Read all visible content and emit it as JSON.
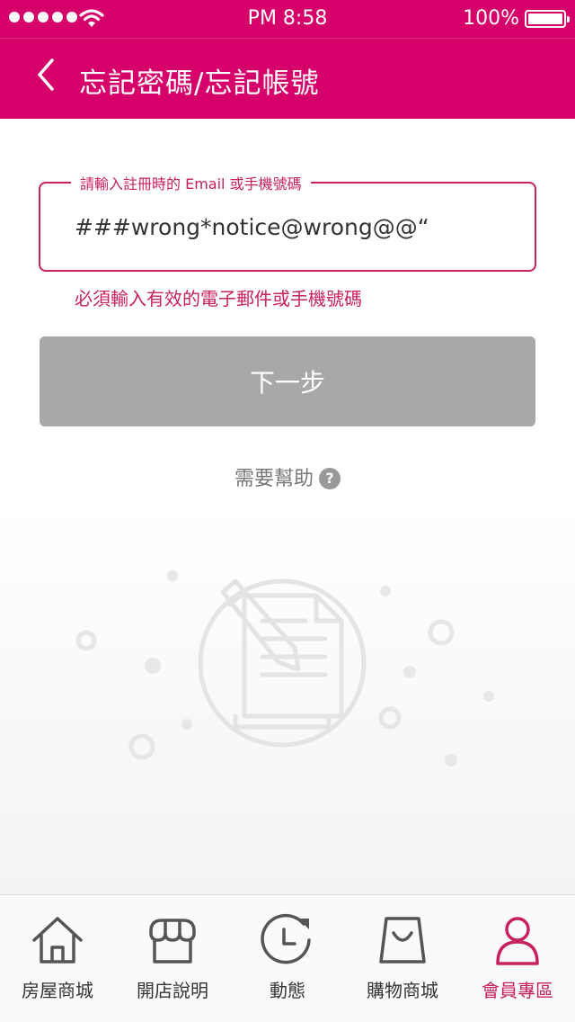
{
  "status_bar": {
    "time": "PM 8:58",
    "battery": "100%"
  },
  "header": {
    "title": "忘記密碼/忘記帳號",
    "back_icon": "chevron-left-icon"
  },
  "form": {
    "field_label": "請輸入註冊時的 Email 或手機號碼",
    "field_value": "###wrong*notice@wrong@@“",
    "error_message": "必須輸入有效的電子郵件或手機號碼",
    "next_label": "下一步",
    "help_label": "需要幫助",
    "help_icon": "question-circle-icon"
  },
  "tab_bar": {
    "items": [
      {
        "label": "房屋商城",
        "icon": "house-icon",
        "active": false
      },
      {
        "label": "開店說明",
        "icon": "storefront-icon",
        "active": false
      },
      {
        "label": "動態",
        "icon": "clock-refresh-icon",
        "active": false
      },
      {
        "label": "購物商城",
        "icon": "shopping-bag-icon",
        "active": false
      },
      {
        "label": "會員專區",
        "icon": "person-icon",
        "active": true
      }
    ]
  },
  "colors": {
    "brand": "#d6006b",
    "error": "#c8215f",
    "disabled_button": "#a8a8a8"
  }
}
